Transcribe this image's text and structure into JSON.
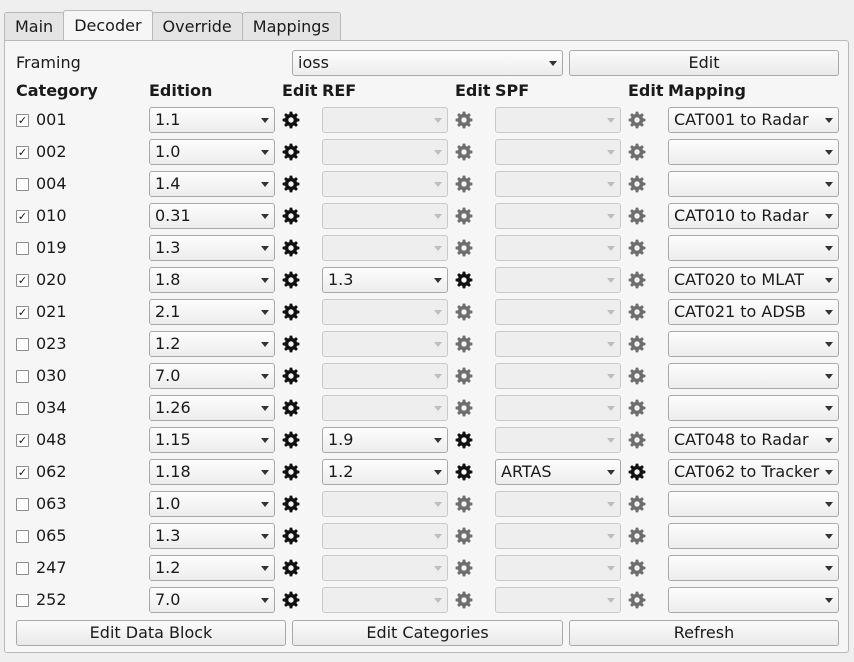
{
  "tabs": [
    "Main",
    "Decoder",
    "Override",
    "Mappings"
  ],
  "active_tab": "Decoder",
  "framing": {
    "label": "Framing",
    "value": "ioss",
    "edit_label": "Edit"
  },
  "headers": {
    "category": "Category",
    "edition": "Edition",
    "edit1": "Edit",
    "ref": "REF",
    "edit2": "Edit",
    "spf": "SPF",
    "edit3": "Edit",
    "mapping": "Mapping"
  },
  "icons": {
    "edit": "gear-icon",
    "checkbox_mark": "check-icon",
    "dropdown": "chevron-down-icon"
  },
  "checkmark": "✓",
  "rows": [
    {
      "category": "001",
      "checked": true,
      "edition": "1.1",
      "ref": "",
      "ref_enabled": false,
      "spf": "",
      "spf_enabled": false,
      "mapping": "CAT001 to Radar"
    },
    {
      "category": "002",
      "checked": true,
      "edition": "1.0",
      "ref": "",
      "ref_enabled": false,
      "spf": "",
      "spf_enabled": false,
      "mapping": ""
    },
    {
      "category": "004",
      "checked": false,
      "edition": "1.4",
      "ref": "",
      "ref_enabled": false,
      "spf": "",
      "spf_enabled": false,
      "mapping": ""
    },
    {
      "category": "010",
      "checked": true,
      "edition": "0.31",
      "ref": "",
      "ref_enabled": false,
      "spf": "",
      "spf_enabled": false,
      "mapping": "CAT010 to Radar"
    },
    {
      "category": "019",
      "checked": false,
      "edition": "1.3",
      "ref": "",
      "ref_enabled": false,
      "spf": "",
      "spf_enabled": false,
      "mapping": ""
    },
    {
      "category": "020",
      "checked": true,
      "edition": "1.8",
      "ref": "1.3",
      "ref_enabled": true,
      "spf": "",
      "spf_enabled": false,
      "mapping": "CAT020 to MLAT"
    },
    {
      "category": "021",
      "checked": true,
      "edition": "2.1",
      "ref": "",
      "ref_enabled": false,
      "spf": "",
      "spf_enabled": false,
      "mapping": "CAT021 to ADSB"
    },
    {
      "category": "023",
      "checked": false,
      "edition": "1.2",
      "ref": "",
      "ref_enabled": false,
      "spf": "",
      "spf_enabled": false,
      "mapping": ""
    },
    {
      "category": "030",
      "checked": false,
      "edition": "7.0",
      "ref": "",
      "ref_enabled": false,
      "spf": "",
      "spf_enabled": false,
      "mapping": ""
    },
    {
      "category": "034",
      "checked": false,
      "edition": "1.26",
      "ref": "",
      "ref_enabled": false,
      "spf": "",
      "spf_enabled": false,
      "mapping": ""
    },
    {
      "category": "048",
      "checked": true,
      "edition": "1.15",
      "ref": "1.9",
      "ref_enabled": true,
      "spf": "",
      "spf_enabled": false,
      "mapping": "CAT048 to Radar"
    },
    {
      "category": "062",
      "checked": true,
      "edition": "1.18",
      "ref": "1.2",
      "ref_enabled": true,
      "spf": "ARTAS",
      "spf_enabled": true,
      "mapping": "CAT062 to Tracker"
    },
    {
      "category": "063",
      "checked": false,
      "edition": "1.0",
      "ref": "",
      "ref_enabled": false,
      "spf": "",
      "spf_enabled": false,
      "mapping": ""
    },
    {
      "category": "065",
      "checked": false,
      "edition": "1.3",
      "ref": "",
      "ref_enabled": false,
      "spf": "",
      "spf_enabled": false,
      "mapping": ""
    },
    {
      "category": "247",
      "checked": false,
      "edition": "1.2",
      "ref": "",
      "ref_enabled": false,
      "spf": "",
      "spf_enabled": false,
      "mapping": ""
    },
    {
      "category": "252",
      "checked": false,
      "edition": "7.0",
      "ref": "",
      "ref_enabled": false,
      "spf": "",
      "spf_enabled": false,
      "mapping": ""
    }
  ],
  "buttons": {
    "edit_data_block": "Edit Data Block",
    "edit_categories": "Edit Categories",
    "refresh": "Refresh"
  },
  "colors": {
    "gear_enabled": "#111111",
    "gear_disabled": "#6e6e6e"
  }
}
